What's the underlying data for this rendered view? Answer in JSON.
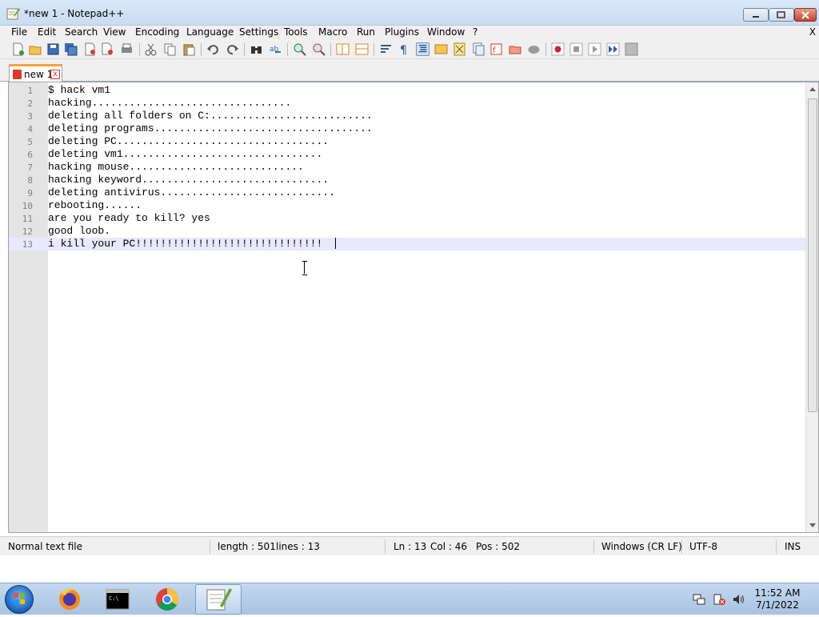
{
  "window": {
    "title": "*new 1 - Notepad++",
    "close_label": "X"
  },
  "menu": [
    "File",
    "Edit",
    "Search",
    "View",
    "Encoding",
    "Language",
    "Settings",
    "Tools",
    "Macro",
    "Run",
    "Plugins",
    "Window",
    "?"
  ],
  "tab": {
    "label": "new 1",
    "close": "x"
  },
  "editor": {
    "lines": [
      "$ hack vm1",
      "hacking................................",
      "deleting all folders on C:..........................",
      "deleting programs...................................",
      "deleting PC..................................",
      "deleting vm1................................",
      "hacking mouse............................",
      "hacking keyword..............................",
      "deleting antivirus............................",
      "rebooting......",
      "are you ready to kill? yes",
      "good loob.",
      "i kill your PC!!!!!!!!!!!!!!!!!!!!!!!!!!!!!!"
    ],
    "line_numbers": [
      "1",
      "2",
      "3",
      "4",
      "5",
      "6",
      "7",
      "8",
      "9",
      "10",
      "11",
      "12",
      "13"
    ],
    "current_line": 13
  },
  "status": {
    "file_type": "Normal text file",
    "length": "length : 501",
    "lines": "lines : 13",
    "ln": "Ln : 13",
    "col": "Col : 46",
    "pos": "Pos : 502",
    "eol": "Windows (CR LF)",
    "encoding": "UTF-8",
    "mode": "INS"
  },
  "taskbar": {
    "time": "11:52 AM",
    "date": "7/1/2022",
    "apps": [
      "firefox-icon",
      "command-prompt-icon",
      "chrome-icon",
      "notepadpp-icon"
    ]
  },
  "colors": {
    "accent_tab": "#f7a23b",
    "current_line": "#e8e8ff",
    "gutter": "#e4e4e4"
  }
}
